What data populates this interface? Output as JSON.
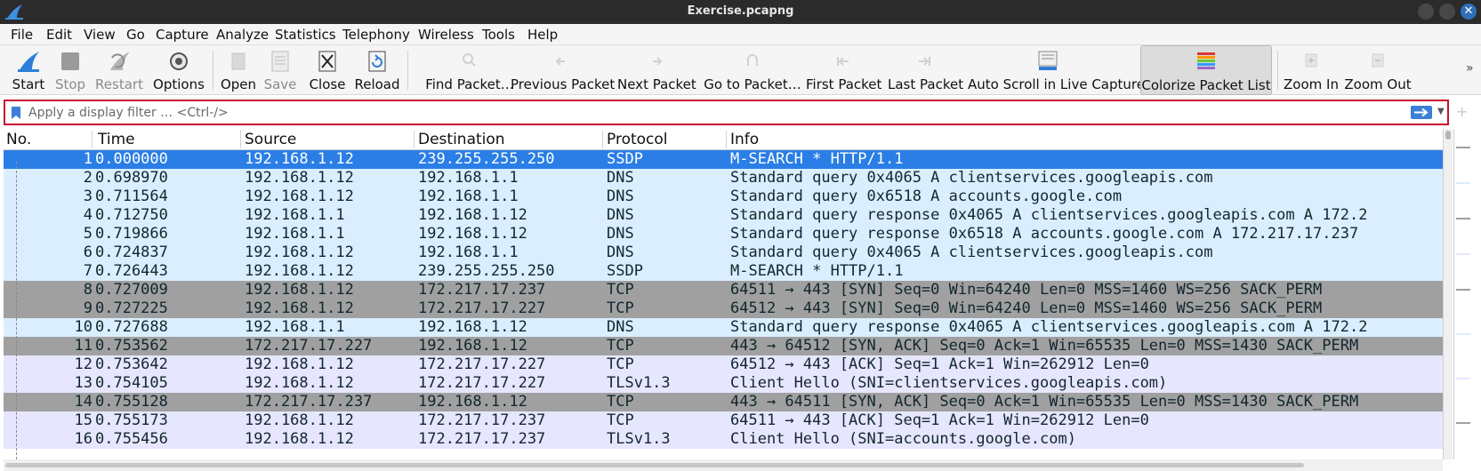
{
  "window": {
    "title": "Exercise.pcapng"
  },
  "menu": [
    "File",
    "Edit",
    "View",
    "Go",
    "Capture",
    "Analyze",
    "Statistics",
    "Telephony",
    "Wireless",
    "Tools",
    "Help"
  ],
  "toolbar": {
    "start": "Start",
    "stop": "Stop",
    "restart": "Restart",
    "options": "Options",
    "open": "Open",
    "save": "Save",
    "close": "Close",
    "reload": "Reload",
    "find_packet": "Find Packet…",
    "previous_packet": "Previous Packet",
    "next_packet": "Next Packet",
    "go_to_packet": "Go to Packet…",
    "first_packet": "First Packet",
    "last_packet": "Last Packet",
    "auto_scroll": "Auto Scroll in Live Capture",
    "colorize": "Colorize Packet List",
    "zoom_in": "Zoom In",
    "zoom_out": "Zoom Out",
    "more": "»"
  },
  "filter": {
    "placeholder": "Apply a display filter … <Ctrl-/>",
    "value": ""
  },
  "columns": {
    "no": "No.",
    "time": "Time",
    "source": "Source",
    "destination": "Destination",
    "protocol": "Protocol",
    "info": "Info"
  },
  "packets": [
    {
      "no": "1",
      "time": "0.000000",
      "source": "192.168.1.12",
      "destination": "239.255.255.250",
      "protocol": "SSDP",
      "info": "M-SEARCH * HTTP/1.1"
    },
    {
      "no": "2",
      "time": "0.698970",
      "source": "192.168.1.12",
      "destination": "192.168.1.1",
      "protocol": "DNS",
      "info": "Standard query 0x4065 A clientservices.googleapis.com"
    },
    {
      "no": "3",
      "time": "0.711564",
      "source": "192.168.1.12",
      "destination": "192.168.1.1",
      "protocol": "DNS",
      "info": "Standard query 0x6518 A accounts.google.com"
    },
    {
      "no": "4",
      "time": "0.712750",
      "source": "192.168.1.1",
      "destination": "192.168.1.12",
      "protocol": "DNS",
      "info": "Standard query response 0x4065 A clientservices.googleapis.com A 172.2"
    },
    {
      "no": "5",
      "time": "0.719866",
      "source": "192.168.1.1",
      "destination": "192.168.1.12",
      "protocol": "DNS",
      "info": "Standard query response 0x6518 A accounts.google.com A 172.217.17.237"
    },
    {
      "no": "6",
      "time": "0.724837",
      "source": "192.168.1.12",
      "destination": "192.168.1.1",
      "protocol": "DNS",
      "info": "Standard query 0x4065 A clientservices.googleapis.com"
    },
    {
      "no": "7",
      "time": "0.726443",
      "source": "192.168.1.12",
      "destination": "239.255.255.250",
      "protocol": "SSDP",
      "info": "M-SEARCH * HTTP/1.1"
    },
    {
      "no": "8",
      "time": "0.727009",
      "source": "192.168.1.12",
      "destination": "172.217.17.237",
      "protocol": "TCP",
      "info": "64511 → 443 [SYN] Seq=0 Win=64240 Len=0 MSS=1460 WS=256 SACK_PERM"
    },
    {
      "no": "9",
      "time": "0.727225",
      "source": "192.168.1.12",
      "destination": "172.217.17.227",
      "protocol": "TCP",
      "info": "64512 → 443 [SYN] Seq=0 Win=64240 Len=0 MSS=1460 WS=256 SACK_PERM"
    },
    {
      "no": "10",
      "time": "0.727688",
      "source": "192.168.1.1",
      "destination": "192.168.1.12",
      "protocol": "DNS",
      "info": "Standard query response 0x4065 A clientservices.googleapis.com A 172.2"
    },
    {
      "no": "11",
      "time": "0.753562",
      "source": "172.217.17.227",
      "destination": "192.168.1.12",
      "protocol": "TCP",
      "info": "443 → 64512 [SYN, ACK] Seq=0 Ack=1 Win=65535 Len=0 MSS=1430 SACK_PERM"
    },
    {
      "no": "12",
      "time": "0.753642",
      "source": "192.168.1.12",
      "destination": "172.217.17.227",
      "protocol": "TCP",
      "info": "64512 → 443 [ACK] Seq=1 Ack=1 Win=262912 Len=0"
    },
    {
      "no": "13",
      "time": "0.754105",
      "source": "192.168.1.12",
      "destination": "172.217.17.227",
      "protocol": "TLSv1.3",
      "info": "Client Hello (SNI=clientservices.googleapis.com)"
    },
    {
      "no": "14",
      "time": "0.755128",
      "source": "172.217.17.237",
      "destination": "192.168.1.12",
      "protocol": "TCP",
      "info": "443 → 64511 [SYN, ACK] Seq=0 Ack=1 Win=65535 Len=0 MSS=1430 SACK_PERM"
    },
    {
      "no": "15",
      "time": "0.755173",
      "source": "192.168.1.12",
      "destination": "172.217.17.237",
      "protocol": "TCP",
      "info": "64511 → 443 [ACK] Seq=1 Ack=1 Win=262912 Len=0"
    },
    {
      "no": "16",
      "time": "0.755456",
      "source": "192.168.1.12",
      "destination": "172.217.17.237",
      "protocol": "TLSv1.3",
      "info": "Client Hello (SNI=accounts.google.com)"
    }
  ],
  "colors": {
    "selected": "#2a7ee6",
    "udp": "#daeeff",
    "tcp": "#e7e6ff",
    "tcp_syn": "#a0a0a0",
    "filter_highlight": "#c8102e"
  }
}
